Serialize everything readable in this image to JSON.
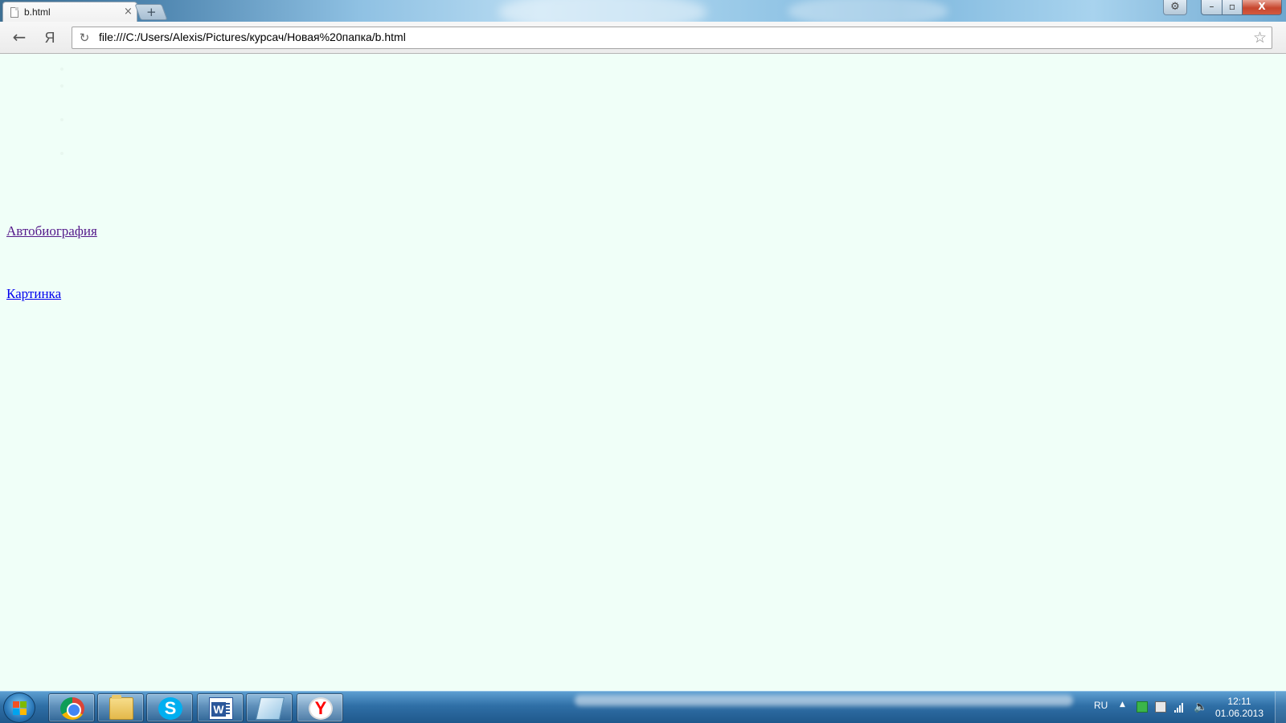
{
  "browser": {
    "tab": {
      "title": "b.html",
      "close": "×"
    },
    "new_tab": "+",
    "settings": "⚙",
    "window": {
      "minimize": "–",
      "maximize": "▫",
      "close": "X"
    },
    "toolbar": {
      "back": "←",
      "yandex": "Я",
      "reload": "↻",
      "url": "file:///C:/Users/Alexis/Pictures/курсач/Новая%20папка/b.html",
      "star": "☆"
    }
  },
  "page": {
    "faded_list": [
      "",
      "",
      "",
      "",
      "",
      "",
      ""
    ],
    "links": [
      {
        "label": "Автобиография",
        "state": "visited",
        "color": "#551a8b"
      },
      {
        "label": "Картинка",
        "state": "unvisited",
        "color": "#0000ee"
      }
    ],
    "background_color": "#f0fff8"
  },
  "taskbar": {
    "apps": [
      {
        "name": "chrome-icon",
        "active": false
      },
      {
        "name": "explorer-folder-icon",
        "active": false
      },
      {
        "name": "skype-icon",
        "label": "S",
        "active": false
      },
      {
        "name": "word-icon",
        "active": false
      },
      {
        "name": "notes-icon",
        "active": false
      },
      {
        "name": "yandex-browser-icon",
        "label": "Y",
        "active": true
      }
    ],
    "tray": {
      "language": "RU",
      "show_hidden": "▲",
      "volume": "🔈"
    },
    "clock": {
      "time": "12:11",
      "date": "01.06.2013"
    }
  }
}
